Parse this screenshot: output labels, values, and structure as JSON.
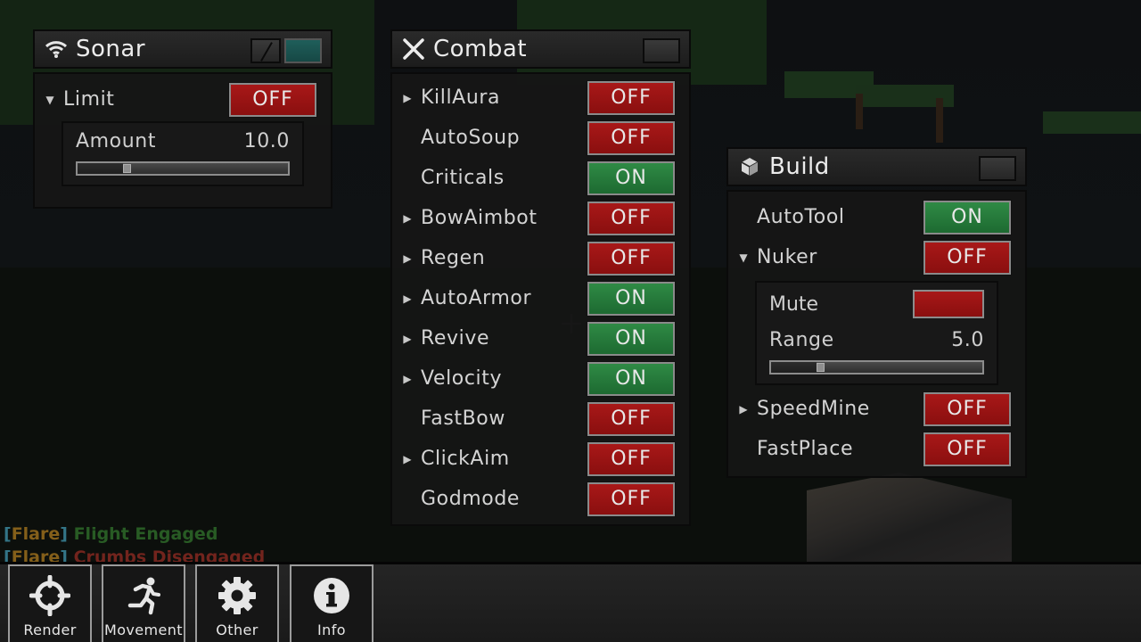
{
  "colors": {
    "off": "#9a1414",
    "on": "#26783b",
    "active_pin": "#1b5451",
    "chat_bracket": "#3d8fa6",
    "chat_name": "#a3741e",
    "chat_engaged": "#2f6e2b",
    "chat_disengaged": "#8c2a22"
  },
  "panels": {
    "sonar": {
      "title": "Sonar",
      "icon": "wifi-icon",
      "rows": [
        {
          "label": "Limit",
          "expand": "expanded",
          "state": "OFF"
        }
      ],
      "limit_slider": {
        "label": "Amount",
        "value": "10.0",
        "fraction": 0.22
      }
    },
    "combat": {
      "title": "Combat",
      "icon": "crossed-swords-icon",
      "rows": [
        {
          "label": "KillAura",
          "expand": "collapsed",
          "state": "OFF"
        },
        {
          "label": "AutoSoup",
          "expand": "none",
          "state": "OFF"
        },
        {
          "label": "Criticals",
          "expand": "none",
          "state": "ON"
        },
        {
          "label": "BowAimbot",
          "expand": "collapsed",
          "state": "OFF"
        },
        {
          "label": "Regen",
          "expand": "collapsed",
          "state": "OFF"
        },
        {
          "label": "AutoArmor",
          "expand": "collapsed",
          "state": "ON"
        },
        {
          "label": "Revive",
          "expand": "collapsed",
          "state": "ON"
        },
        {
          "label": "Velocity",
          "expand": "collapsed",
          "state": "ON"
        },
        {
          "label": "FastBow",
          "expand": "none",
          "state": "OFF"
        },
        {
          "label": "ClickAim",
          "expand": "collapsed",
          "state": "OFF"
        },
        {
          "label": "Godmode",
          "expand": "none",
          "state": "OFF"
        }
      ]
    },
    "build": {
      "title": "Build",
      "icon": "cube-icon",
      "rows": [
        {
          "label": "AutoTool",
          "expand": "none",
          "state": "ON"
        },
        {
          "label": "Nuker",
          "expand": "expanded",
          "state": "OFF"
        },
        {
          "label": "SpeedMine",
          "expand": "collapsed",
          "state": "OFF"
        },
        {
          "label": "FastPlace",
          "expand": "none",
          "state": "OFF"
        }
      ],
      "nuker_settings": {
        "mute_label": "Mute",
        "mute_state": "off",
        "range_label": "Range",
        "range_value": "5.0",
        "range_fraction": 0.22
      }
    }
  },
  "chat": [
    {
      "open": "[",
      "name": "Flare",
      "close": "]",
      "message": "Flight Engaged",
      "kind": "ok"
    },
    {
      "open": "[",
      "name": "Flare",
      "close": "]",
      "message": "Crumbs Disengaged",
      "kind": "bad"
    }
  ],
  "bottom_nav": [
    {
      "label": "Render",
      "icon": "crosshair-icon"
    },
    {
      "label": "Movement",
      "icon": "running-person-icon"
    },
    {
      "label": "Other",
      "icon": "gear-icon"
    },
    {
      "label": "Info",
      "icon": "info-icon"
    }
  ]
}
